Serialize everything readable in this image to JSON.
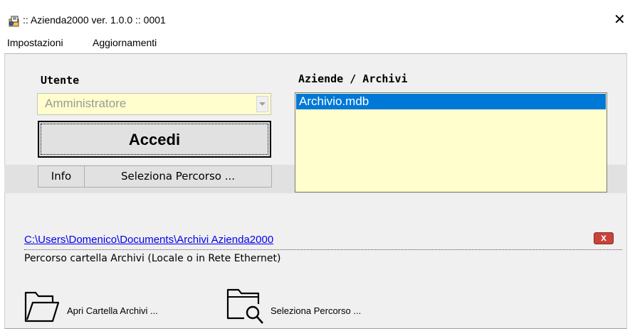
{
  "window": {
    "title": ":: Azienda2000  ver. 1.0.0 :: 0001",
    "close_glyph": "✕"
  },
  "menu": {
    "items": [
      "Impostazioni",
      "Aggiornamenti"
    ]
  },
  "user": {
    "label": "Utente",
    "selected": "Amministratore"
  },
  "login": {
    "button_label": "Accedi"
  },
  "buttons": {
    "info": "Info",
    "select_path": "Seleziona Percorso ..."
  },
  "archives": {
    "label": "Aziende / Archivi",
    "items": [
      "Archivio.mdb"
    ],
    "selected_index": 0
  },
  "path": {
    "value": "C:\\Users\\Domenico\\Documents\\Archivi Azienda2000",
    "caption": "Percorso cartella Archivi (Locale o in Rete Ethernet)",
    "clear_glyph": "x"
  },
  "actions": {
    "open_folder": "Apri Cartella Archivi ...",
    "select_path": "Seleziona Percorso ..."
  },
  "colors": {
    "field_bg": "#fffecc",
    "selection": "#0078d7",
    "panel": "#f0f0f0",
    "link": "#0000ee"
  },
  "icons": [
    "app-icon",
    "close-icon",
    "combo-arrow-icon",
    "clear-path-icon",
    "open-folder-icon",
    "search-folder-icon"
  ]
}
